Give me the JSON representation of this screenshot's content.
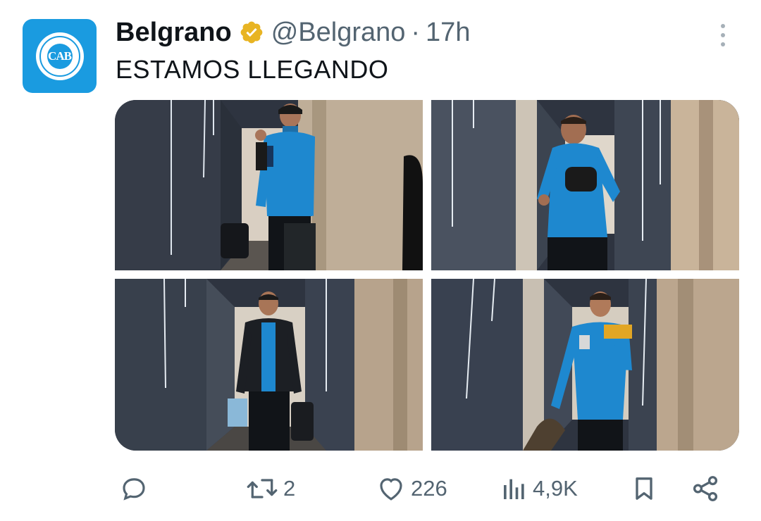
{
  "tweet": {
    "display_name": "Belgrano",
    "handle": "@Belgrano",
    "separator": "·",
    "time": "17h",
    "text": "ESTAMOS LLEGANDO",
    "avatar": {
      "crest_letters": "CAB",
      "color": "#1a9be0"
    },
    "verified_badge_color": "#e8b423",
    "photos": [
      {
        "description": "Player in blue jacket walking down hotel corridor with bag and suitcase"
      },
      {
        "description": "Smiling player in blue jacket holding backpack in corridor"
      },
      {
        "description": "Player in black puffer vest carrying bags in corridor"
      },
      {
        "description": "Player in blue jacket holding phone and bag in corridor"
      }
    ]
  },
  "actions": {
    "reply": {
      "icon": "reply-icon",
      "count": ""
    },
    "retweet": {
      "icon": "retweet-icon",
      "count": "2"
    },
    "like": {
      "icon": "heart-icon",
      "count": "226"
    },
    "views": {
      "icon": "views-icon",
      "count": "4,9K"
    },
    "bookmark": {
      "icon": "bookmark-icon"
    },
    "share": {
      "icon": "share-icon"
    }
  }
}
